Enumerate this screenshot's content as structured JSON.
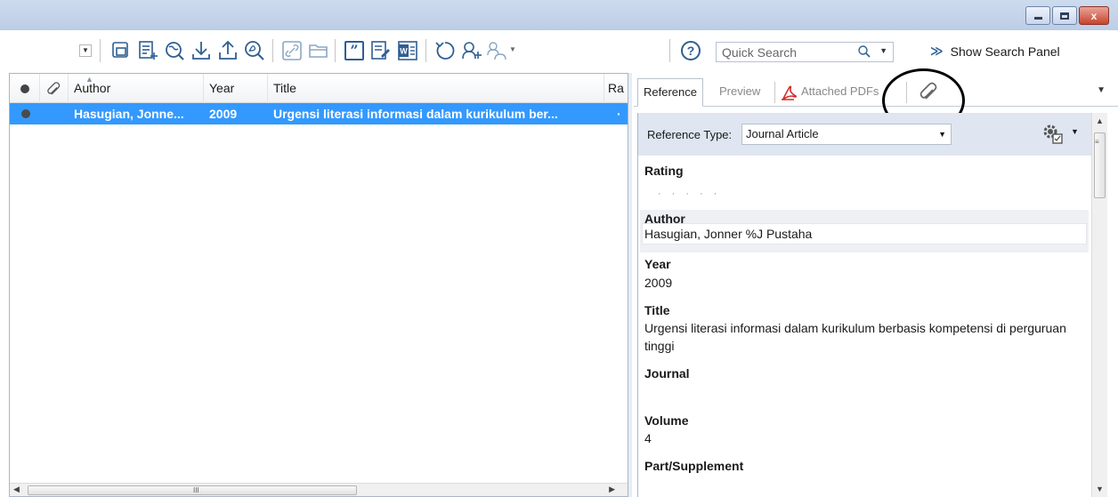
{
  "window": {
    "minimize_icon": "minimize-icon",
    "maximize_icon": "maximize-icon",
    "close_label": "x"
  },
  "toolbar": {
    "icons": [
      "groups-icon",
      "new-reference-icon",
      "online-search-icon",
      "import-icon",
      "export-icon",
      "find-pdf-icon",
      "open-link-icon",
      "open-folder-icon",
      "insert-citation-icon",
      "format-bibliography-icon",
      "word-icon",
      "sync-icon",
      "share-icon",
      "share-group-icon",
      "help-icon"
    ],
    "quote_label": "”",
    "help_label": "?",
    "search": {
      "placeholder": "Quick Search"
    },
    "show_search_label": "Show Search Panel"
  },
  "library": {
    "columns": {
      "read": "",
      "attachment": "",
      "author": "Author",
      "year": "Year",
      "title": "Title",
      "rating": "Ra"
    },
    "rows": [
      {
        "author": "Hasugian, Jonne...",
        "year": "2009",
        "title": "Urgensi literasi informasi dalam kurikulum ber...",
        "rating": "·"
      }
    ],
    "scroll_grip": "III"
  },
  "tabs": {
    "reference": "Reference",
    "preview": "Preview",
    "attached_pdfs": "Attached PDFs"
  },
  "reference": {
    "type_label": "Reference Type:",
    "type_value": "Journal Article",
    "fields": {
      "rating_label": "Rating",
      "rating_dots": "·····",
      "author_label": "Author",
      "author_value": "Hasugian, Jonner %J Pustaha",
      "year_label": "Year",
      "year_value": "2009",
      "title_label": "Title",
      "title_value": "Urgensi literasi informasi dalam kurikulum berbasis kompetensi di perguruan tinggi",
      "journal_label": "Journal",
      "journal_value": "",
      "volume_label": "Volume",
      "volume_value": "4",
      "part_label": "Part/Supplement"
    }
  },
  "colors": {
    "selection": "#3399ff",
    "accent": "#2e5f93",
    "titlebar": "#c5d5ea",
    "panel_band": "#dfe6f1"
  }
}
